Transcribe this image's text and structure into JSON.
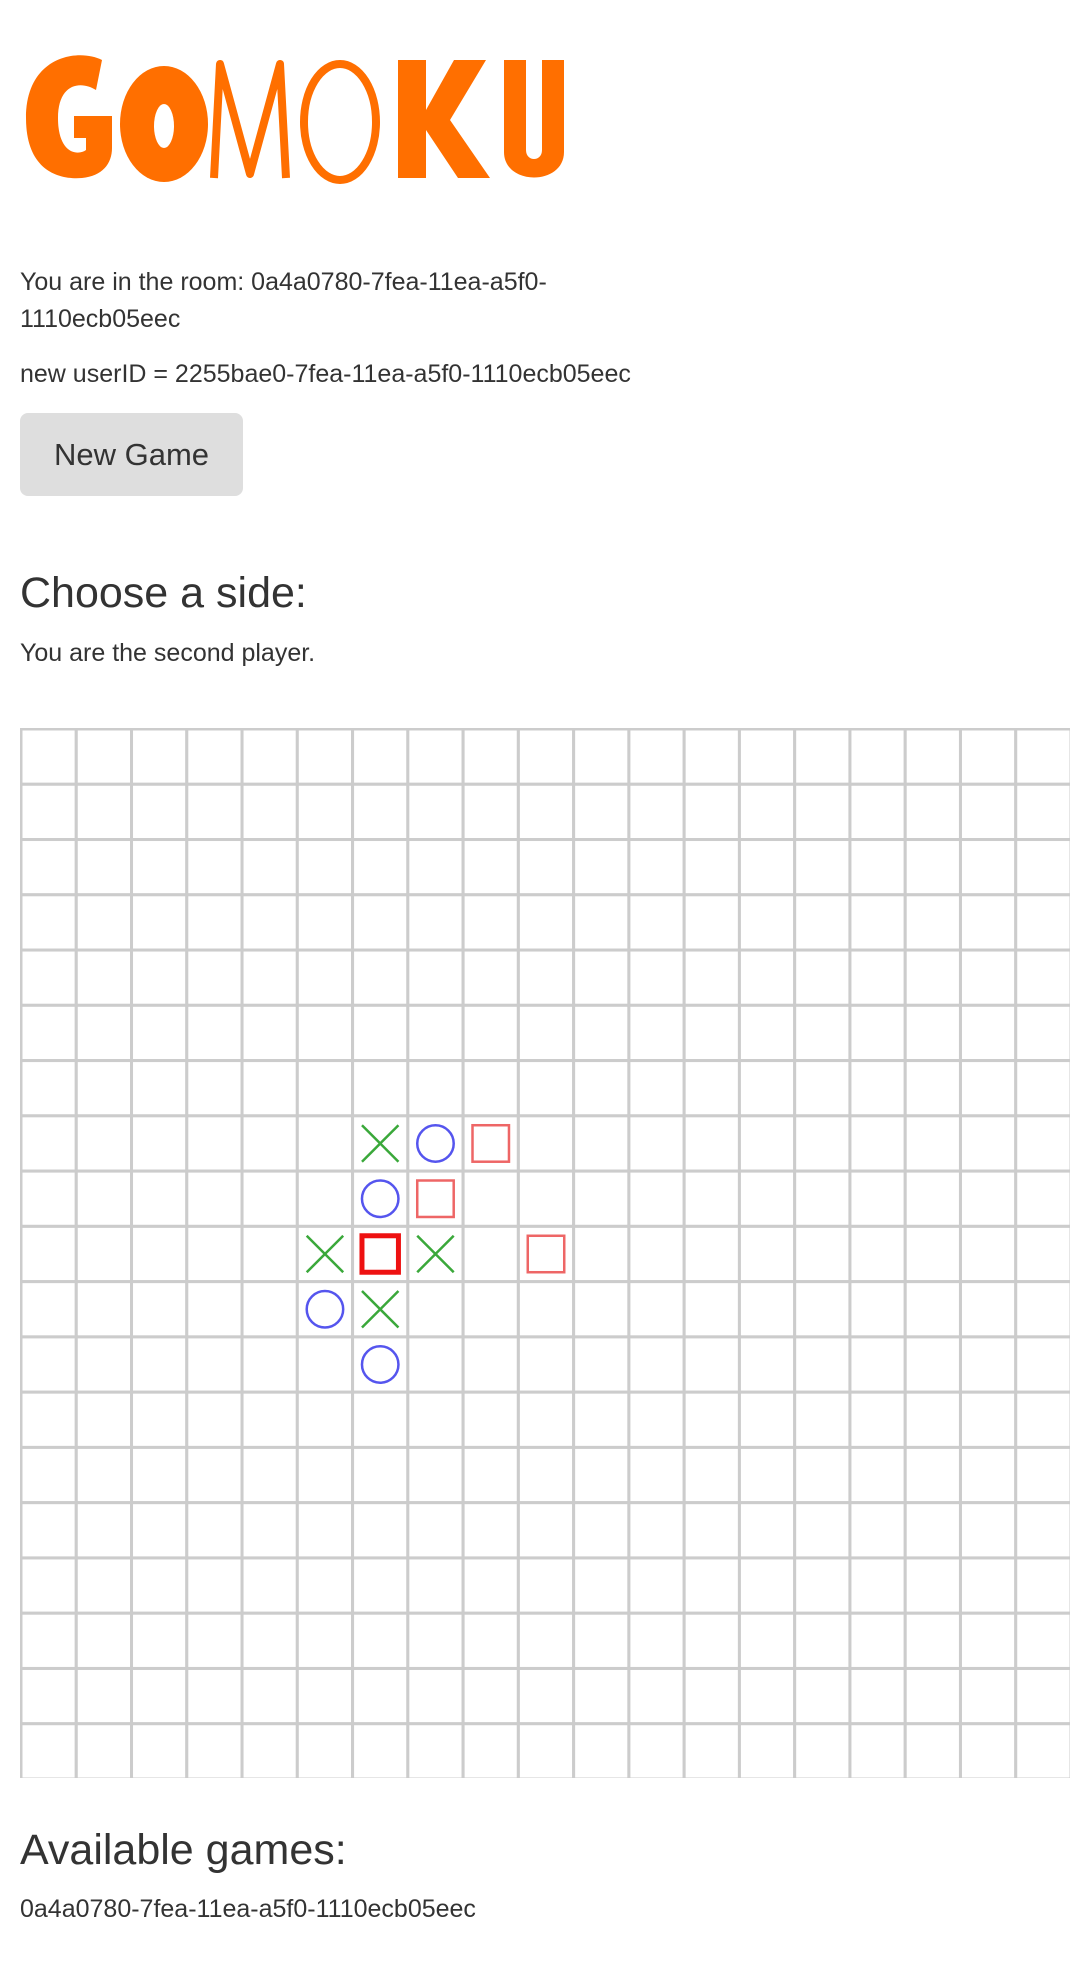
{
  "logo": {
    "text": "GOMOKU",
    "color": "#ff6f00"
  },
  "room": {
    "text": "You are in the room: 0a4a0780-7fea-11ea-a5f0-1110ecb05eec"
  },
  "user": {
    "text": "new userID = 2255bae0-7fea-11ea-a5f0-1110ecb05eec"
  },
  "new_game_button": {
    "label": "New Game"
  },
  "choose_side": {
    "heading": "Choose a side:",
    "status": "You are the second player."
  },
  "board": {
    "rows": 19,
    "cols": 19,
    "grid_color": "#cccccc",
    "colors": {
      "x": "#3aa83a",
      "o": "#5555ee",
      "square": "#ee6666",
      "square_last": "#ee1111"
    },
    "pieces": [
      {
        "row": 7,
        "col": 6,
        "type": "x"
      },
      {
        "row": 7,
        "col": 7,
        "type": "o"
      },
      {
        "row": 7,
        "col": 8,
        "type": "square"
      },
      {
        "row": 8,
        "col": 6,
        "type": "o"
      },
      {
        "row": 8,
        "col": 7,
        "type": "square"
      },
      {
        "row": 9,
        "col": 5,
        "type": "x"
      },
      {
        "row": 9,
        "col": 6,
        "type": "square",
        "last": true
      },
      {
        "row": 9,
        "col": 7,
        "type": "x"
      },
      {
        "row": 9,
        "col": 9,
        "type": "square"
      },
      {
        "row": 10,
        "col": 5,
        "type": "o"
      },
      {
        "row": 10,
        "col": 6,
        "type": "x"
      },
      {
        "row": 11,
        "col": 6,
        "type": "o"
      }
    ]
  },
  "available_games": {
    "heading": "Available games:",
    "items": [
      "0a4a0780-7fea-11ea-a5f0-1110ecb05eec"
    ]
  }
}
